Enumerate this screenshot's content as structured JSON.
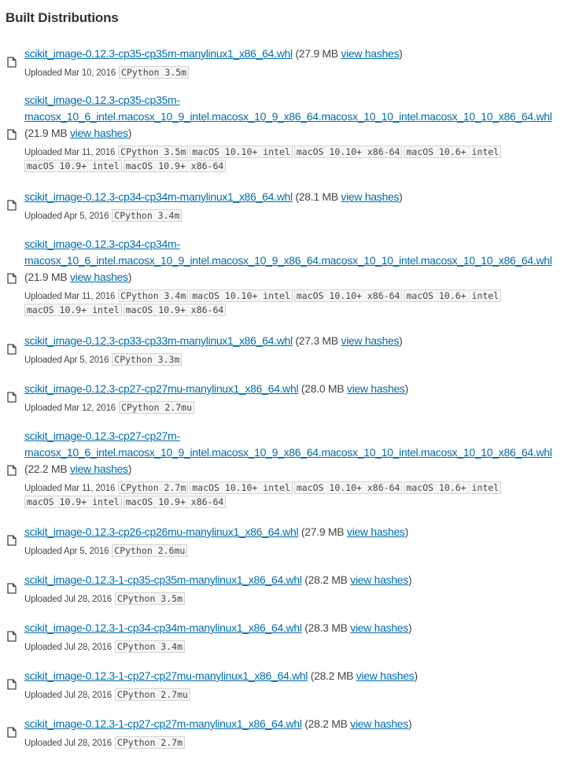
{
  "heading": "Built Distributions",
  "uploaded_prefix": "Uploaded",
  "view_hashes_label": "view hashes",
  "files": [
    {
      "name": "scikit_image-0.12.3-cp35-cp35m-manylinux1_x86_64.whl",
      "size": "(27.9 MB",
      "date": "Mar 10, 2016",
      "tags": [
        "CPython 3.5m"
      ]
    },
    {
      "name1": "scikit_image-0.12.3-cp35-cp35m-",
      "name2": "macosx_10_6_intel.macosx_10_9_intel.macosx_10_9_x86_64.macosx_10_10_intel.macosx_10_10_x86_64.whl",
      "size": "(21.9 MB",
      "date": "Mar 11, 2016",
      "tags": [
        "CPython 3.5m",
        "macOS 10.10+ intel",
        "macOS 10.10+ x86-64",
        "macOS 10.6+ intel",
        "macOS 10.9+ intel",
        "macOS 10.9+ x86-64"
      ]
    },
    {
      "name": "scikit_image-0.12.3-cp34-cp34m-manylinux1_x86_64.whl",
      "size": "(28.1 MB",
      "date": "Apr 5, 2016",
      "tags": [
        "CPython 3.4m"
      ]
    },
    {
      "name1": "scikit_image-0.12.3-cp34-cp34m-",
      "name2": "macosx_10_6_intel.macosx_10_9_intel.macosx_10_9_x86_64.macosx_10_10_intel.macosx_10_10_x86_64.whl",
      "size": "(21.9 MB",
      "date": "Mar 11, 2016",
      "tags": [
        "CPython 3.4m",
        "macOS 10.10+ intel",
        "macOS 10.10+ x86-64",
        "macOS 10.6+ intel",
        "macOS 10.9+ intel",
        "macOS 10.9+ x86-64"
      ]
    },
    {
      "name": "scikit_image-0.12.3-cp33-cp33m-manylinux1_x86_64.whl",
      "size": "(27.3 MB",
      "date": "Apr 5, 2016",
      "tags": [
        "CPython 3.3m"
      ]
    },
    {
      "name": "scikit_image-0.12.3-cp27-cp27mu-manylinux1_x86_64.whl",
      "size": "(28.0 MB",
      "date": "Mar 12, 2016",
      "tags": [
        "CPython 2.7mu"
      ]
    },
    {
      "name1": "scikit_image-0.12.3-cp27-cp27m-",
      "name2": "macosx_10_6_intel.macosx_10_9_intel.macosx_10_9_x86_64.macosx_10_10_intel.macosx_10_10_x86_64.whl",
      "size": "(22.2 MB",
      "date": "Mar 11, 2016",
      "tags": [
        "CPython 2.7m",
        "macOS 10.10+ intel",
        "macOS 10.10+ x86-64",
        "macOS 10.6+ intel",
        "macOS 10.9+ intel",
        "macOS 10.9+ x86-64"
      ]
    },
    {
      "name": "scikit_image-0.12.3-cp26-cp26mu-manylinux1_x86_64.whl",
      "size": "(27.9 MB",
      "date": "Apr 5, 2016",
      "tags": [
        "CPython 2.6mu"
      ]
    },
    {
      "name": "scikit_image-0.12.3-1-cp35-cp35m-manylinux1_x86_64.whl",
      "size": "(28.2 MB",
      "date": "Jul 28, 2016",
      "tags": [
        "CPython 3.5m"
      ]
    },
    {
      "name": "scikit_image-0.12.3-1-cp34-cp34m-manylinux1_x86_64.whl",
      "size": "(28.3 MB",
      "date": "Jul 28, 2016",
      "tags": [
        "CPython 3.4m"
      ]
    },
    {
      "name": "scikit_image-0.12.3-1-cp27-cp27mu-manylinux1_x86_64.whl",
      "size": "(28.2 MB",
      "date": "Jul 28, 2016",
      "tags": [
        "CPython 2.7mu"
      ]
    },
    {
      "name": "scikit_image-0.12.3-1-cp27-cp27m-manylinux1_x86_64.whl",
      "size": "(28.2 MB",
      "date": "Jul 28, 2016",
      "tags": [
        "CPython 2.7m"
      ]
    }
  ]
}
